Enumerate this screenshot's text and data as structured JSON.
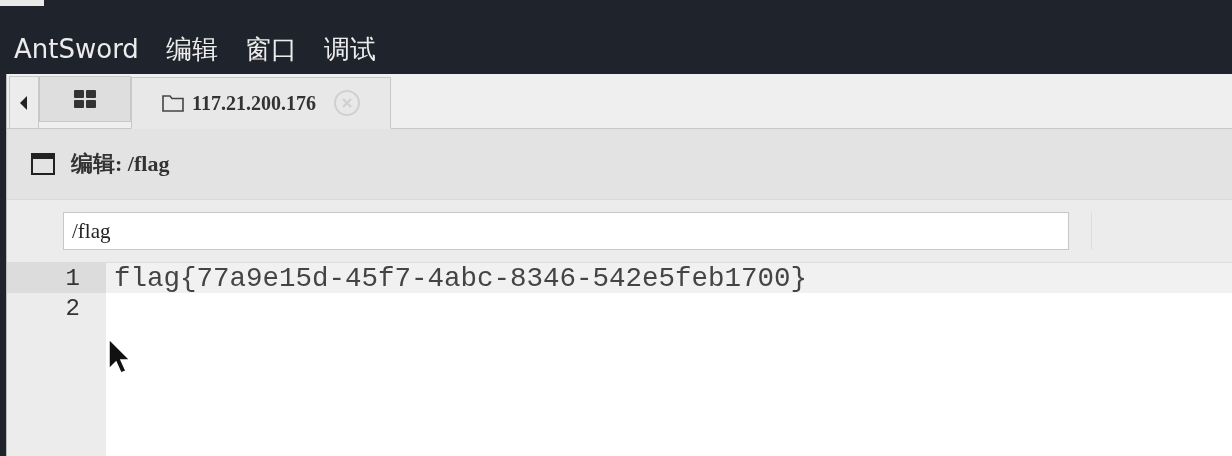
{
  "menu_bar": {
    "items": [
      "AntSword",
      "编辑",
      "窗口",
      "调试"
    ]
  },
  "tabs": [
    {
      "kind": "home",
      "selected": false
    },
    {
      "kind": "folder",
      "label": "117.21.200.176",
      "selected": true,
      "closable": true
    }
  ],
  "panel": {
    "title": "编辑: /flag"
  },
  "path_field": {
    "value": "/flag"
  },
  "editor": {
    "lines": [
      {
        "number": "1",
        "text": "flag{77a9e15d-45f7-4abc-8346-542e5feb1700}",
        "active": true
      },
      {
        "number": "2",
        "active": false
      }
    ]
  }
}
